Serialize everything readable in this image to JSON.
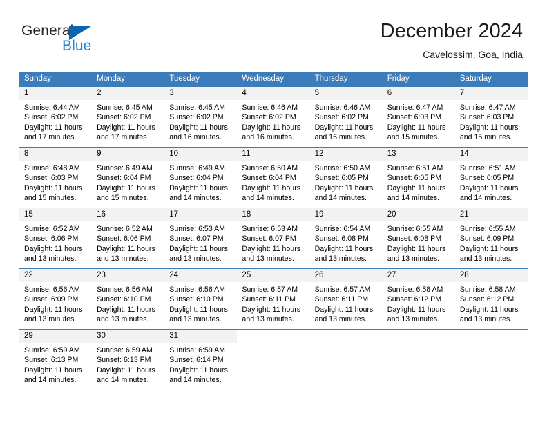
{
  "brand": {
    "name_part1": "General",
    "name_part2": "Blue",
    "triangle_color": "#0a64b0",
    "blue_text_color": "#1b7fd4"
  },
  "header": {
    "title": "December 2024",
    "subtitle": "Cavelossim, Goa, India"
  },
  "theme": {
    "header_blue": "#3c7cba",
    "daynum_strip": "#f2f2f2",
    "text": "#000000"
  },
  "labels": {
    "sunrise_prefix": "Sunrise:",
    "sunset_prefix": "Sunset:",
    "daylight_prefix": "Daylight:"
  },
  "weekdays": [
    "Sunday",
    "Monday",
    "Tuesday",
    "Wednesday",
    "Thursday",
    "Friday",
    "Saturday"
  ],
  "weeks": [
    [
      {
        "day": "1",
        "sunrise": "Sunrise: 6:44 AM",
        "sunset": "Sunset: 6:02 PM",
        "daylight1": "Daylight: 11 hours",
        "daylight2": "and 17 minutes."
      },
      {
        "day": "2",
        "sunrise": "Sunrise: 6:45 AM",
        "sunset": "Sunset: 6:02 PM",
        "daylight1": "Daylight: 11 hours",
        "daylight2": "and 17 minutes."
      },
      {
        "day": "3",
        "sunrise": "Sunrise: 6:45 AM",
        "sunset": "Sunset: 6:02 PM",
        "daylight1": "Daylight: 11 hours",
        "daylight2": "and 16 minutes."
      },
      {
        "day": "4",
        "sunrise": "Sunrise: 6:46 AM",
        "sunset": "Sunset: 6:02 PM",
        "daylight1": "Daylight: 11 hours",
        "daylight2": "and 16 minutes."
      },
      {
        "day": "5",
        "sunrise": "Sunrise: 6:46 AM",
        "sunset": "Sunset: 6:02 PM",
        "daylight1": "Daylight: 11 hours",
        "daylight2": "and 16 minutes."
      },
      {
        "day": "6",
        "sunrise": "Sunrise: 6:47 AM",
        "sunset": "Sunset: 6:03 PM",
        "daylight1": "Daylight: 11 hours",
        "daylight2": "and 15 minutes."
      },
      {
        "day": "7",
        "sunrise": "Sunrise: 6:47 AM",
        "sunset": "Sunset: 6:03 PM",
        "daylight1": "Daylight: 11 hours",
        "daylight2": "and 15 minutes."
      }
    ],
    [
      {
        "day": "8",
        "sunrise": "Sunrise: 6:48 AM",
        "sunset": "Sunset: 6:03 PM",
        "daylight1": "Daylight: 11 hours",
        "daylight2": "and 15 minutes."
      },
      {
        "day": "9",
        "sunrise": "Sunrise: 6:49 AM",
        "sunset": "Sunset: 6:04 PM",
        "daylight1": "Daylight: 11 hours",
        "daylight2": "and 15 minutes."
      },
      {
        "day": "10",
        "sunrise": "Sunrise: 6:49 AM",
        "sunset": "Sunset: 6:04 PM",
        "daylight1": "Daylight: 11 hours",
        "daylight2": "and 14 minutes."
      },
      {
        "day": "11",
        "sunrise": "Sunrise: 6:50 AM",
        "sunset": "Sunset: 6:04 PM",
        "daylight1": "Daylight: 11 hours",
        "daylight2": "and 14 minutes."
      },
      {
        "day": "12",
        "sunrise": "Sunrise: 6:50 AM",
        "sunset": "Sunset: 6:05 PM",
        "daylight1": "Daylight: 11 hours",
        "daylight2": "and 14 minutes."
      },
      {
        "day": "13",
        "sunrise": "Sunrise: 6:51 AM",
        "sunset": "Sunset: 6:05 PM",
        "daylight1": "Daylight: 11 hours",
        "daylight2": "and 14 minutes."
      },
      {
        "day": "14",
        "sunrise": "Sunrise: 6:51 AM",
        "sunset": "Sunset: 6:05 PM",
        "daylight1": "Daylight: 11 hours",
        "daylight2": "and 14 minutes."
      }
    ],
    [
      {
        "day": "15",
        "sunrise": "Sunrise: 6:52 AM",
        "sunset": "Sunset: 6:06 PM",
        "daylight1": "Daylight: 11 hours",
        "daylight2": "and 13 minutes."
      },
      {
        "day": "16",
        "sunrise": "Sunrise: 6:52 AM",
        "sunset": "Sunset: 6:06 PM",
        "daylight1": "Daylight: 11 hours",
        "daylight2": "and 13 minutes."
      },
      {
        "day": "17",
        "sunrise": "Sunrise: 6:53 AM",
        "sunset": "Sunset: 6:07 PM",
        "daylight1": "Daylight: 11 hours",
        "daylight2": "and 13 minutes."
      },
      {
        "day": "18",
        "sunrise": "Sunrise: 6:53 AM",
        "sunset": "Sunset: 6:07 PM",
        "daylight1": "Daylight: 11 hours",
        "daylight2": "and 13 minutes."
      },
      {
        "day": "19",
        "sunrise": "Sunrise: 6:54 AM",
        "sunset": "Sunset: 6:08 PM",
        "daylight1": "Daylight: 11 hours",
        "daylight2": "and 13 minutes."
      },
      {
        "day": "20",
        "sunrise": "Sunrise: 6:55 AM",
        "sunset": "Sunset: 6:08 PM",
        "daylight1": "Daylight: 11 hours",
        "daylight2": "and 13 minutes."
      },
      {
        "day": "21",
        "sunrise": "Sunrise: 6:55 AM",
        "sunset": "Sunset: 6:09 PM",
        "daylight1": "Daylight: 11 hours",
        "daylight2": "and 13 minutes."
      }
    ],
    [
      {
        "day": "22",
        "sunrise": "Sunrise: 6:56 AM",
        "sunset": "Sunset: 6:09 PM",
        "daylight1": "Daylight: 11 hours",
        "daylight2": "and 13 minutes."
      },
      {
        "day": "23",
        "sunrise": "Sunrise: 6:56 AM",
        "sunset": "Sunset: 6:10 PM",
        "daylight1": "Daylight: 11 hours",
        "daylight2": "and 13 minutes."
      },
      {
        "day": "24",
        "sunrise": "Sunrise: 6:56 AM",
        "sunset": "Sunset: 6:10 PM",
        "daylight1": "Daylight: 11 hours",
        "daylight2": "and 13 minutes."
      },
      {
        "day": "25",
        "sunrise": "Sunrise: 6:57 AM",
        "sunset": "Sunset: 6:11 PM",
        "daylight1": "Daylight: 11 hours",
        "daylight2": "and 13 minutes."
      },
      {
        "day": "26",
        "sunrise": "Sunrise: 6:57 AM",
        "sunset": "Sunset: 6:11 PM",
        "daylight1": "Daylight: 11 hours",
        "daylight2": "and 13 minutes."
      },
      {
        "day": "27",
        "sunrise": "Sunrise: 6:58 AM",
        "sunset": "Sunset: 6:12 PM",
        "daylight1": "Daylight: 11 hours",
        "daylight2": "and 13 minutes."
      },
      {
        "day": "28",
        "sunrise": "Sunrise: 6:58 AM",
        "sunset": "Sunset: 6:12 PM",
        "daylight1": "Daylight: 11 hours",
        "daylight2": "and 13 minutes."
      }
    ],
    [
      {
        "day": "29",
        "sunrise": "Sunrise: 6:59 AM",
        "sunset": "Sunset: 6:13 PM",
        "daylight1": "Daylight: 11 hours",
        "daylight2": "and 14 minutes."
      },
      {
        "day": "30",
        "sunrise": "Sunrise: 6:59 AM",
        "sunset": "Sunset: 6:13 PM",
        "daylight1": "Daylight: 11 hours",
        "daylight2": "and 14 minutes."
      },
      {
        "day": "31",
        "sunrise": "Sunrise: 6:59 AM",
        "sunset": "Sunset: 6:14 PM",
        "daylight1": "Daylight: 11 hours",
        "daylight2": "and 14 minutes."
      },
      {
        "day": "",
        "sunrise": "",
        "sunset": "",
        "daylight1": "",
        "daylight2": ""
      },
      {
        "day": "",
        "sunrise": "",
        "sunset": "",
        "daylight1": "",
        "daylight2": ""
      },
      {
        "day": "",
        "sunrise": "",
        "sunset": "",
        "daylight1": "",
        "daylight2": ""
      },
      {
        "day": "",
        "sunrise": "",
        "sunset": "",
        "daylight1": "",
        "daylight2": ""
      }
    ]
  ]
}
